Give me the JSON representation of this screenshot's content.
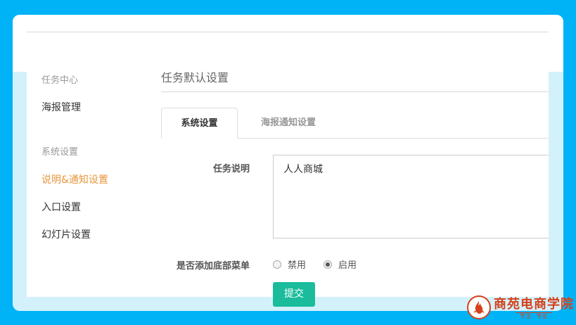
{
  "sidebar": {
    "group1": "任务中心",
    "item_poster": "海报管理",
    "group2": "系统设置",
    "item_notice": "说明&通知设置",
    "item_entry": "入口设置",
    "item_slides": "幻灯片设置"
  },
  "page": {
    "title": "任务默认设置"
  },
  "tabs": [
    {
      "label": "系统设置",
      "active": true
    },
    {
      "label": "海报通知设置",
      "active": false
    }
  ],
  "form": {
    "desc_label": "任务说明",
    "desc_value": "人人商城",
    "menu_label": "是否添加底部菜单",
    "option_disable": "禁用",
    "option_enable": "启用",
    "selected": "启用",
    "submit_label": "提交"
  },
  "watermark": {
    "main_text": "商苑电商学院",
    "sub_text": "专注 · 专业"
  },
  "colors": {
    "background": "#00b3f7",
    "accent_active": "#e8963d",
    "submit": "#1abc9c",
    "watermark": "#d6401b"
  }
}
